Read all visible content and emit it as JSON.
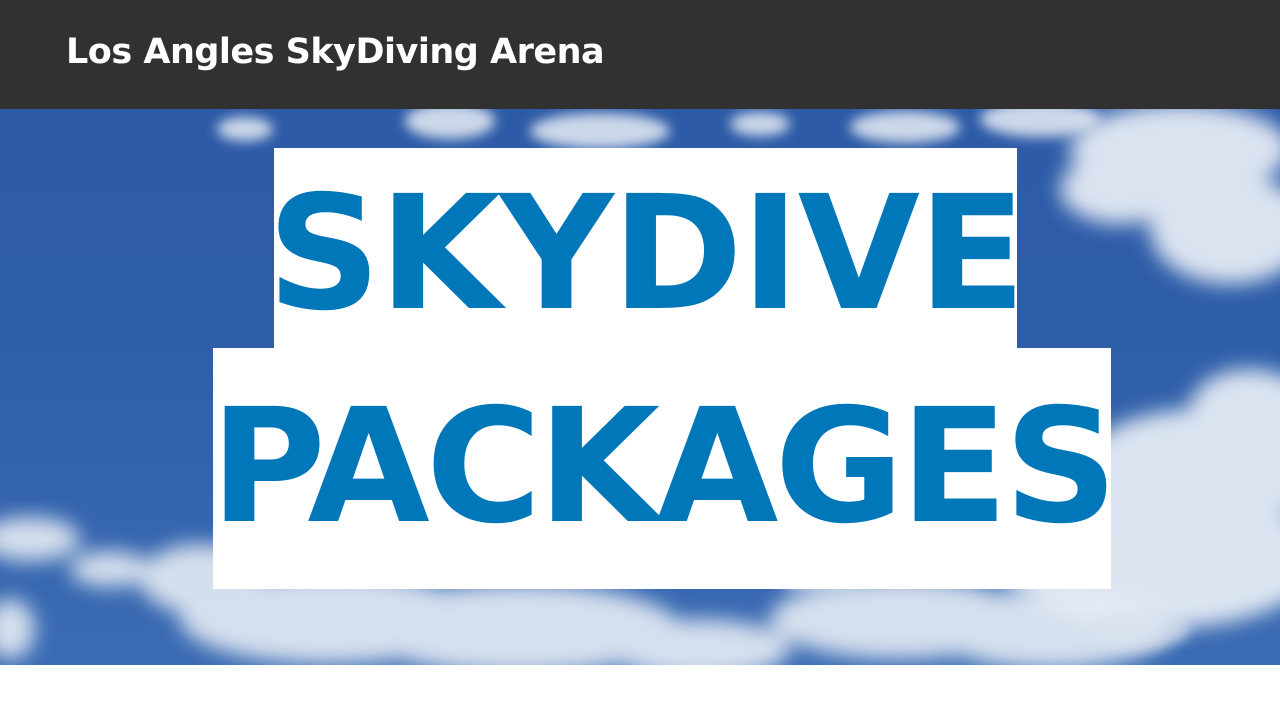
{
  "header": {
    "site_title": "Los Angles SkyDiving Arena"
  },
  "hero": {
    "headline_line1": "SKYDIVE",
    "headline_line2": "PACKAGES",
    "headline_color": "#0077b8",
    "sky_color": "#2e5ea9",
    "header_bg": "#313131"
  }
}
